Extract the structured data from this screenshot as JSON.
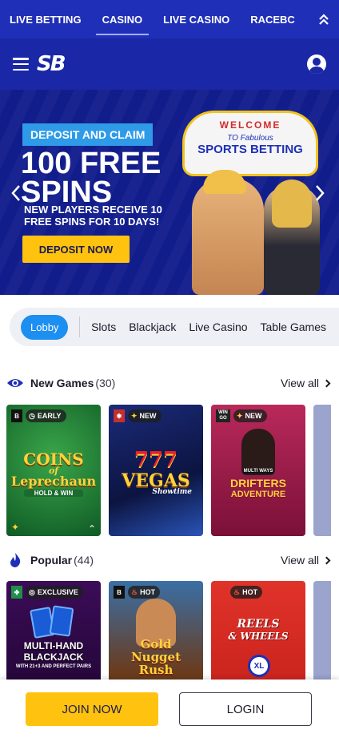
{
  "topnav": {
    "tabs": [
      {
        "label": "LIVE BETTING"
      },
      {
        "label": "CASINO"
      },
      {
        "label": "LIVE CASINO"
      },
      {
        "label": "RACEBC"
      }
    ],
    "active_tab": "CASINO"
  },
  "header": {
    "logo_text": "SB"
  },
  "banner": {
    "pill": "DEPOSIT AND CLAIM",
    "headline": "100 FREE SPINS",
    "subtext": "NEW PLAYERS RECEIVE 10 FREE SPINS FOR 10 DAYS!",
    "cta": "DEPOSIT NOW",
    "sign_welcome": "WELCOME",
    "sign_to": "TO Fabulous",
    "sign_brand": "SPORTS BETTING"
  },
  "filter": {
    "lobby": "Lobby",
    "categories": [
      "Slots",
      "Blackjack",
      "Live Casino",
      "Table Games"
    ]
  },
  "sections": {
    "new_games": {
      "title": "New Games",
      "count": "(30)",
      "view_all": "View all",
      "tiles": [
        {
          "badge": "EARLY",
          "title_top": "COINS",
          "title_mid": "of",
          "title_bottom": "Leprechaun",
          "tagline": "HOLD & WIN"
        },
        {
          "badge": "NEW",
          "title_top": "777",
          "title_mid": "VEGAS",
          "title_bottom": "Showtime"
        },
        {
          "badge": "NEW",
          "provider": "WIN GO",
          "title_top": "MULTI WAYS",
          "title_mid": "DRIFTERS",
          "title_bottom": "ADVENTURE"
        }
      ]
    },
    "popular": {
      "title": "Popular",
      "count": "(44)",
      "view_all": "View all",
      "tiles": [
        {
          "badge": "EXCLUSIVE",
          "title_top": "MULTI-HAND",
          "title_mid": "BLACKJACK",
          "title_bottom": "WITH 21+3 AND PERFECT PAIRS"
        },
        {
          "badge": "HOT",
          "title_top": "Gold",
          "title_mid": "Nugget",
          "title_bottom": "Rush"
        },
        {
          "badge": "HOT",
          "title_top": "REELS",
          "title_mid": "& WHEELS",
          "title_bottom": "XL"
        }
      ]
    }
  },
  "bottom_bar": {
    "join": "JOIN NOW",
    "login": "LOGIN"
  },
  "colors": {
    "nav_blue": "#1f2fb8",
    "header_blue": "#1a27a6",
    "accent_yellow": "#ffc20e",
    "lobby_blue": "#1c8ff0"
  }
}
